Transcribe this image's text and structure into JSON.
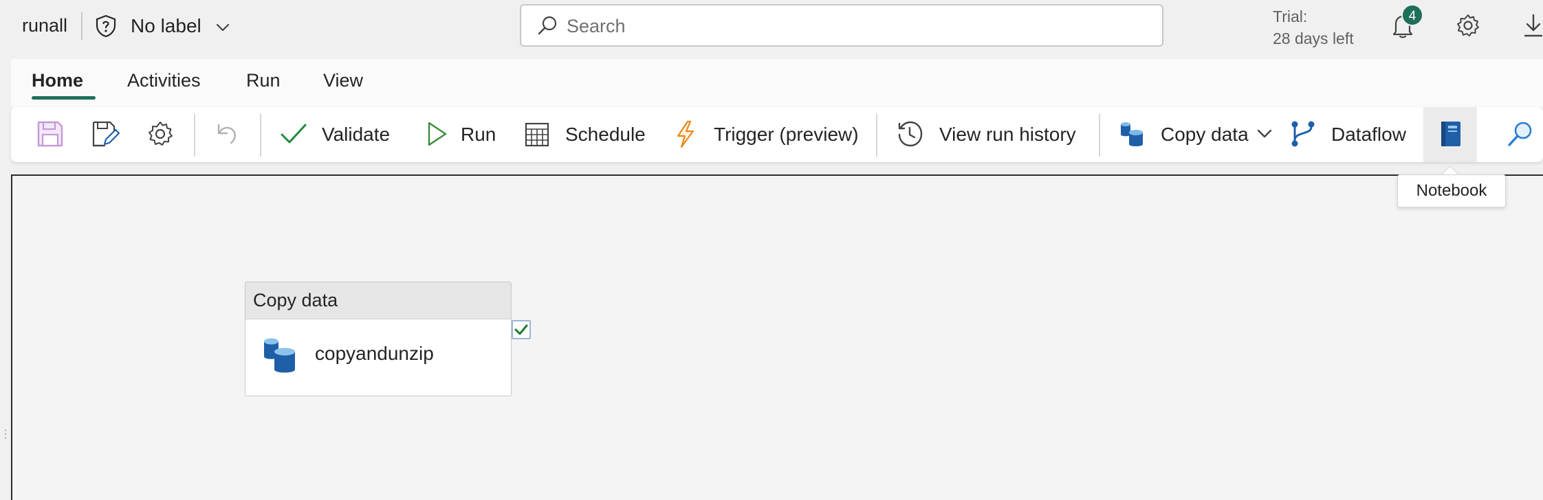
{
  "header": {
    "workspace_name": "runall",
    "sensitivity_label": "No label",
    "search_placeholder": "Search",
    "trial_line1": "Trial:",
    "trial_line2": "28 days left",
    "notification_count": "4"
  },
  "tabs": [
    {
      "label": "Home",
      "active": true
    },
    {
      "label": "Activities"
    },
    {
      "label": "Run"
    },
    {
      "label": "View"
    }
  ],
  "ribbon": {
    "validate_label": "Validate",
    "run_label": "Run",
    "schedule_label": "Schedule",
    "trigger_label": "Trigger (preview)",
    "history_label": "View run history",
    "copy_label": "Copy data",
    "dataflow_label": "Dataflow"
  },
  "tooltip": {
    "text": "Notebook"
  },
  "activity": {
    "type_label": "Copy data",
    "name": "copyandunzip"
  },
  "colors": {
    "accent": "#1f6f5a",
    "copy_data_blue": "#1f5fa8",
    "trigger_orange": "#e8891a",
    "validate_green": "#1e8a3c",
    "run_green": "#3b8a3e",
    "save_pink": "#c49ad6"
  }
}
